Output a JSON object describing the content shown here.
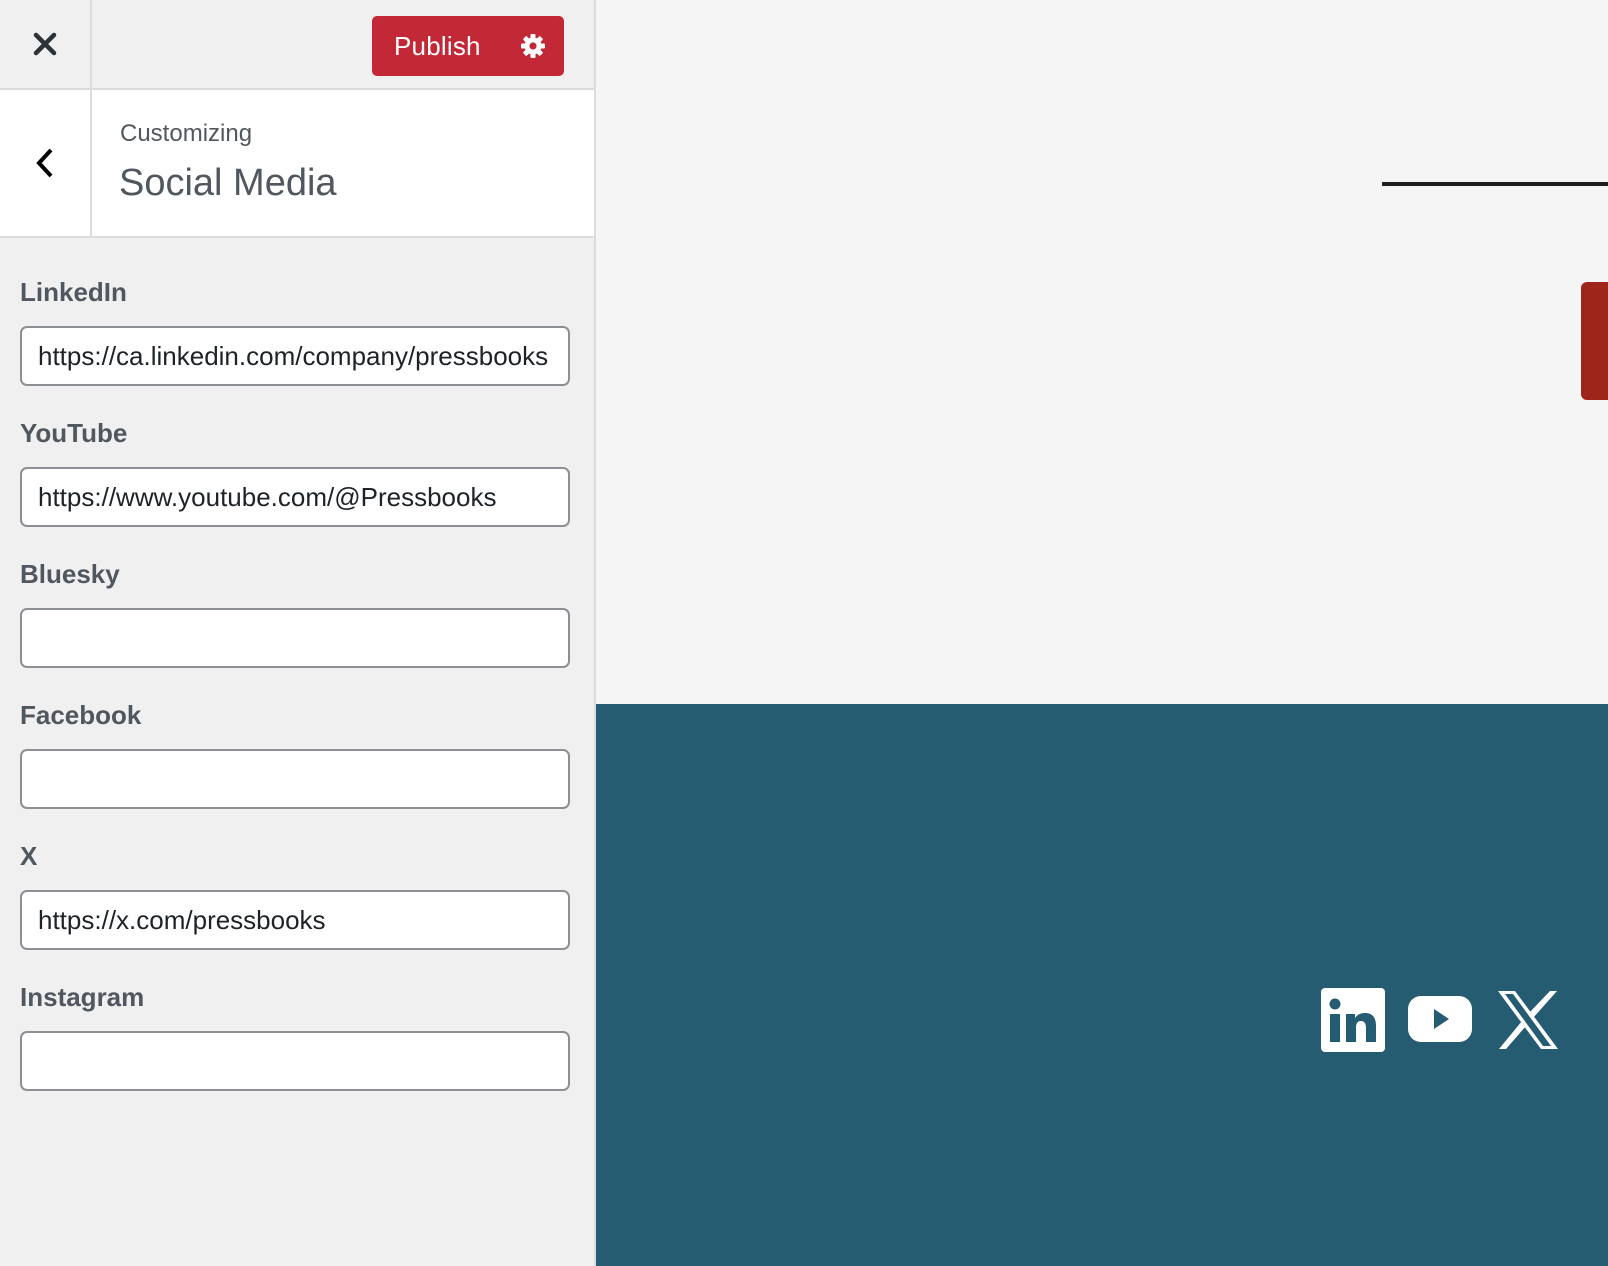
{
  "topbar": {
    "close_label": "Close",
    "publish_label": "Publish",
    "publish_color": "#c32837"
  },
  "section": {
    "breadcrumb": "Customizing",
    "title": "Social Media"
  },
  "fields": [
    {
      "label": "LinkedIn",
      "value": "https://ca.linkedin.com/company/pressbooks",
      "placeholder": ""
    },
    {
      "label": "YouTube",
      "value": "https://www.youtube.com/@Pressbooks",
      "placeholder": ""
    },
    {
      "label": "Bluesky",
      "value": "",
      "placeholder": ""
    },
    {
      "label": "Facebook",
      "value": "",
      "placeholder": ""
    },
    {
      "label": "X",
      "value": "https://x.com/pressbooks",
      "placeholder": ""
    },
    {
      "label": "Instagram",
      "value": "",
      "placeholder": ""
    }
  ],
  "preview": {
    "footer_color": "#255c72",
    "accent_color": "#9e251a",
    "social_icons": [
      "linkedin-icon",
      "youtube-icon",
      "x-icon"
    ]
  }
}
